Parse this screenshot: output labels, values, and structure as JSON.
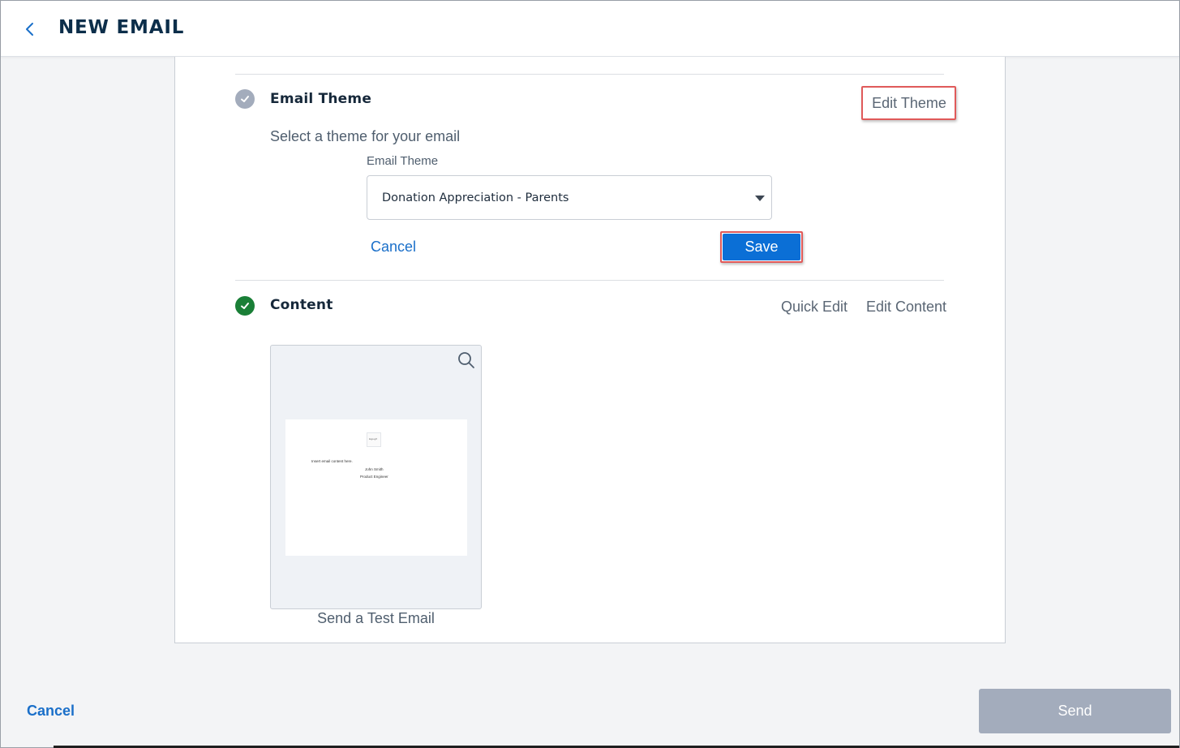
{
  "header": {
    "title": "NEW EMAIL",
    "back_icon": "chevron-left-icon"
  },
  "email_theme_section": {
    "title": "Email Theme",
    "status_icon": "check-circle-icon",
    "status_color": "#a3acbc",
    "edit_link": "Edit Theme",
    "description": "Select a theme for your email",
    "field_label": "Email Theme",
    "selected_value": "Donation Appreciation - Parents",
    "cancel_label": "Cancel",
    "save_label": "Save"
  },
  "content_section": {
    "title": "Content",
    "status_icon": "check-circle-icon",
    "status_color": "#1a7f37",
    "quick_edit_link": "Quick Edit",
    "edit_content_link": "Edit Content",
    "preview": {
      "logo_text": "logo.gif",
      "body_text": "Insert email content here.",
      "signature_name": "John Smith",
      "signature_title": "Product Engineer",
      "zoom_icon": "search-icon"
    },
    "test_email_link": "Send a Test Email"
  },
  "footer": {
    "cancel_label": "Cancel",
    "send_label": "Send"
  },
  "colors": {
    "accent": "#0b6fd6",
    "link": "#1a6fc9",
    "highlight": "#e05a5a",
    "disabled": "#a3acbc"
  }
}
